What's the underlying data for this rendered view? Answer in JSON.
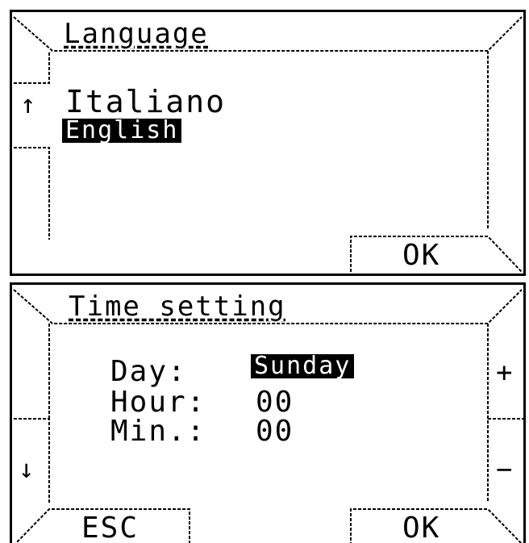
{
  "language_screen": {
    "title": "Language",
    "up_arrow": "↑",
    "options": [
      "Italiano",
      "English"
    ],
    "selected": "English",
    "ok_label": "OK"
  },
  "time_screen": {
    "title": "Time setting",
    "day_label": "Day:",
    "day_value": "Sunday",
    "hour_label": "Hour:",
    "hour_value": "00",
    "min_label": "Min.:",
    "min_value": "00",
    "down_arrow": "↓",
    "plus_label": "+",
    "minus_label": "−",
    "esc_label": "ESC",
    "ok_label": "OK"
  }
}
